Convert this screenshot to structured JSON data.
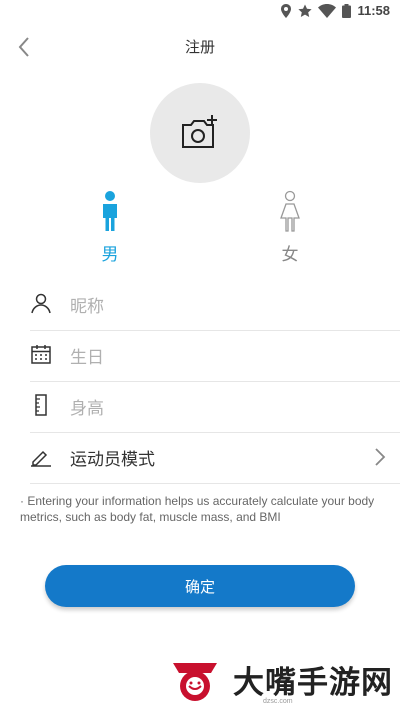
{
  "status_bar": {
    "time": "11:58"
  },
  "header": {
    "title": "注册"
  },
  "gender": {
    "male_label": "男",
    "female_label": "女",
    "selected": "male"
  },
  "form": {
    "nickname_placeholder": "昵称",
    "birthday_placeholder": "生日",
    "height_placeholder": "身高",
    "athlete_mode_label": "运动员模式"
  },
  "hint": "· Entering your information helps us accurately calculate your body metrics, such as body fat, muscle mass, and BMI",
  "confirm_label": "确定",
  "watermark": {
    "text": "大嘴手游网",
    "url": "dzsc.com"
  },
  "colors": {
    "accent": "#1aa3dd",
    "button": "#1479c9",
    "placeholder": "#b0b0b0"
  }
}
